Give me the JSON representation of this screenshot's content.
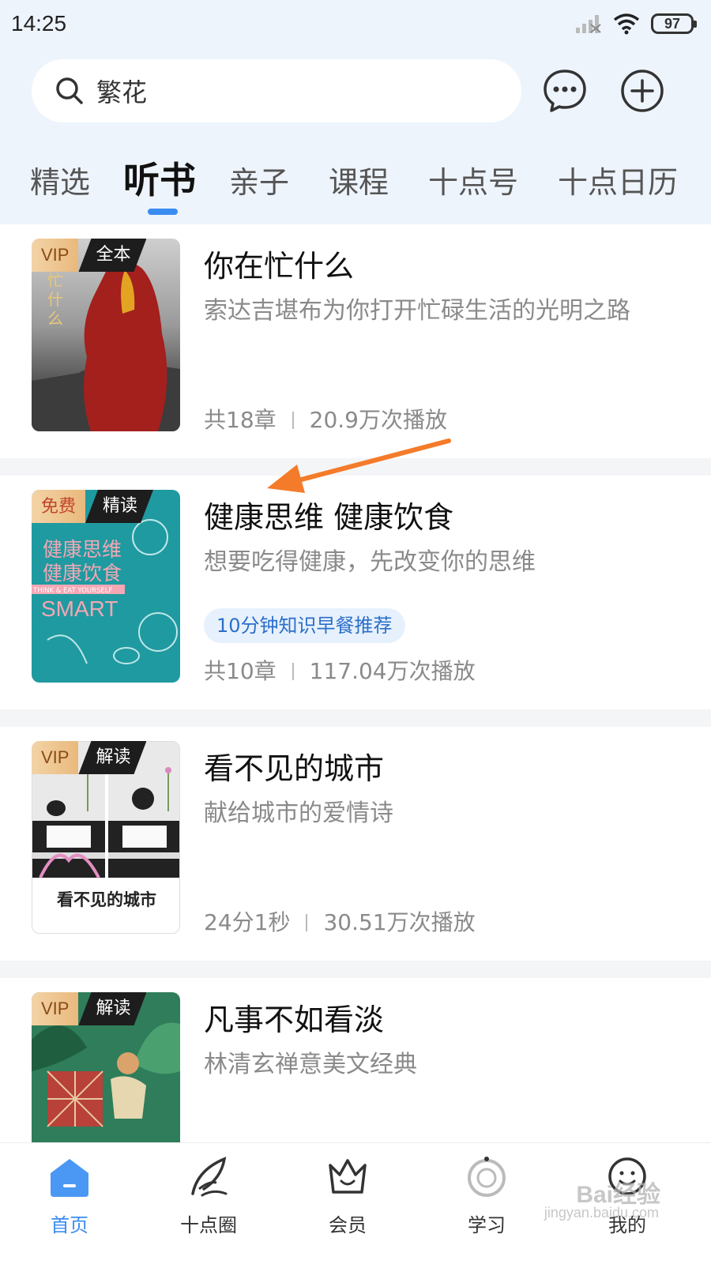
{
  "status": {
    "time": "14:25",
    "battery": "97"
  },
  "search": {
    "query": "繁花"
  },
  "tabs": [
    {
      "label": "精选"
    },
    {
      "label": "听书"
    },
    {
      "label": "亲子"
    },
    {
      "label": "课程"
    },
    {
      "label": "十点号"
    },
    {
      "label": "十点日历"
    }
  ],
  "active_tab": "听书",
  "accent_color": "#3b8cf0",
  "books": [
    {
      "badge_a": "VIP",
      "badge_b": "全本",
      "title": "你在忙什么",
      "subtitle": "索达吉堪布为你打开忙碌生活的光明之路",
      "meta_left": "共18章",
      "meta_right": "20.9万次播放"
    },
    {
      "badge_a": "免费",
      "badge_b": "精读",
      "title": "健康思维 健康饮食",
      "subtitle": "想要吃得健康，先改变你的思维",
      "tag": "10分钟知识早餐推荐",
      "cover_line1": "健康思维",
      "cover_line2": "健康饮食",
      "cover_banner": "THINK & EAT YOURSELF",
      "cover_smart": "SMART",
      "meta_left": "共10章",
      "meta_right": "117.04万次播放"
    },
    {
      "badge_a": "VIP",
      "badge_b": "解读",
      "title": "看不见的城市",
      "subtitle": "献给城市的爱情诗",
      "cover_title": "看不见的城市",
      "meta_left": "24分1秒",
      "meta_right": "30.51万次播放"
    },
    {
      "badge_a": "VIP",
      "badge_b": "解读",
      "title": "凡事不如看淡",
      "subtitle": "林清玄禅意美文经典"
    }
  ],
  "bottom_nav": [
    {
      "label": "首页",
      "icon": "home-icon"
    },
    {
      "label": "十点圈",
      "icon": "feather-icon"
    },
    {
      "label": "会员",
      "icon": "crown-icon"
    },
    {
      "label": "学习",
      "icon": "study-icon"
    },
    {
      "label": "我的",
      "icon": "profile-icon"
    }
  ],
  "watermark": {
    "main": "Bai经验",
    "sub": "jingyan.baidu.com"
  }
}
